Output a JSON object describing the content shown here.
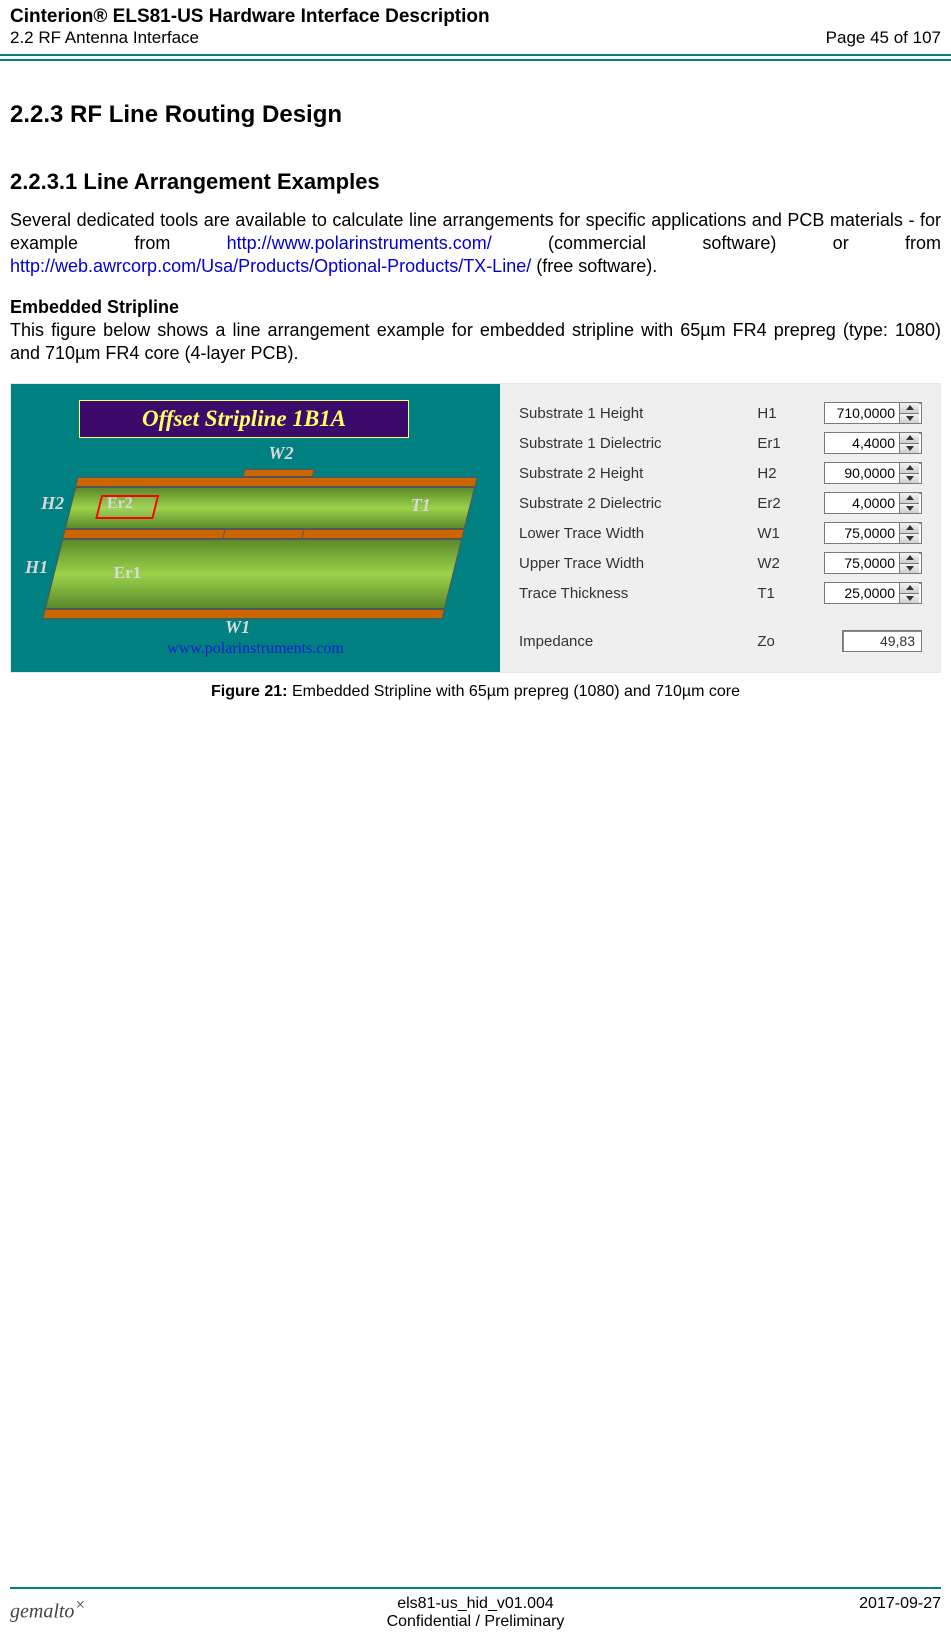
{
  "header": {
    "title": "Cinterion® ELS81-US Hardware Interface Description",
    "subtitle": "2.2 RF Antenna Interface",
    "page": "Page 45 of 107"
  },
  "section": {
    "num_title": "2.2.3      RF Line Routing Design",
    "sub_num_title": "2.2.3.1        Line Arrangement Examples",
    "para1_a": "Several dedicated tools are available to calculate line arrangements for specific applications and PCB materials - for example from ",
    "link1": "http://www.polarinstruments.com/",
    "para1_b": " (commercial software) or  from ",
    "link2": "http://web.awrcorp.com/Usa/Products/Optional-Products/TX-Line/",
    "para1_c": "  (free software).",
    "strip_head": "Embedded Stripline",
    "strip_body": "This figure below shows a line arrangement example for embedded stripline with 65µm FR4 prepreg (type: 1080) and 710µm FR4 core (4-layer PCB)."
  },
  "figure": {
    "banner": "Offset Stripline 1B1A",
    "url": "www.polarinstruments.com",
    "labels": {
      "H1": "H1",
      "H2": "H2",
      "Er1": "Er1",
      "Er2": "Er2",
      "W1": "W1",
      "W2": "W2",
      "T1": "T1"
    },
    "props": [
      {
        "name": "Substrate 1 Height",
        "sym": "H1",
        "val": "710,0000"
      },
      {
        "name": "Substrate 1 Dielectric",
        "sym": "Er1",
        "val": "4,4000"
      },
      {
        "name": "Substrate 2 Height",
        "sym": "H2",
        "val": "90,0000"
      },
      {
        "name": "Substrate 2 Dielectric",
        "sym": "Er2",
        "val": "4,0000"
      },
      {
        "name": "Lower Trace Width",
        "sym": "W1",
        "val": "75,0000"
      },
      {
        "name": "Upper Trace Width",
        "sym": "W2",
        "val": "75,0000"
      },
      {
        "name": "Trace Thickness",
        "sym": "T1",
        "val": "25,0000"
      }
    ],
    "impedance": {
      "name": "Impedance",
      "sym": "Zo",
      "val": "49,83"
    },
    "caption_prefix": "Figure 21:",
    "caption": "  Embedded Stripline with 65µm prepreg (1080) and 710µm core"
  },
  "footer": {
    "brand": "gemalto",
    "docid": "els81-us_hid_v01.004",
    "conf": "Confidential / Preliminary",
    "date": "2017-09-27"
  }
}
